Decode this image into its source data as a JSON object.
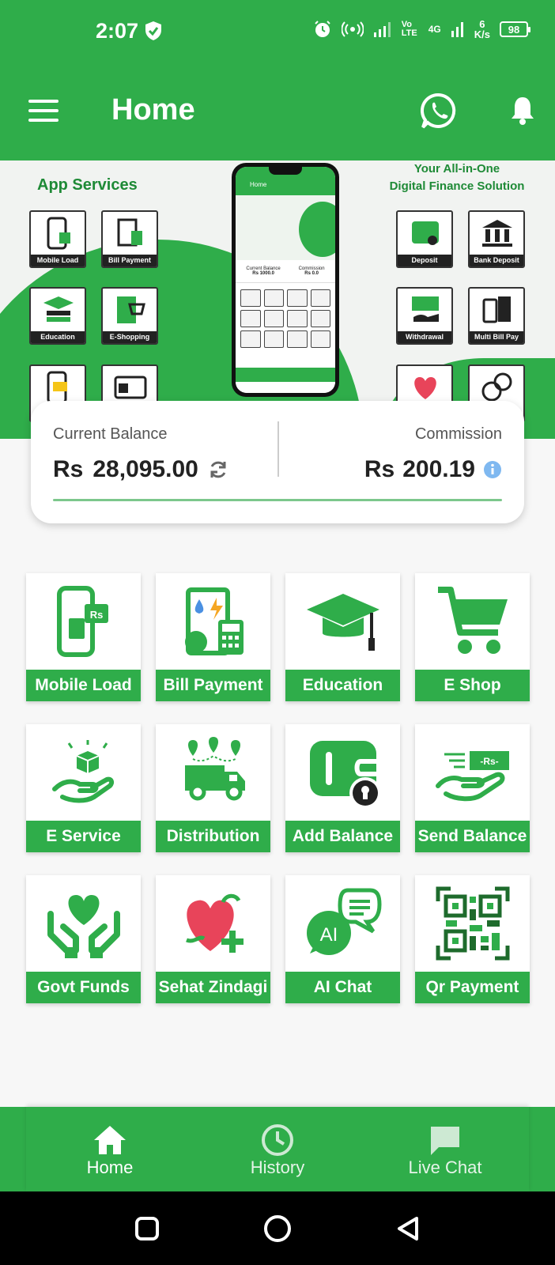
{
  "status_bar": {
    "time": "2:07",
    "network_label": "Vo LTE",
    "network_type": "4G",
    "speed_value": "6",
    "speed_unit": "K/s",
    "battery": "98"
  },
  "header": {
    "title": "Home",
    "menu_icon": "hamburger-menu-icon",
    "whatsapp_icon": "whatsapp-icon",
    "notification_icon": "bell-icon"
  },
  "banner": {
    "left_title": "App Services",
    "right_title_line1": "Your All-in-One",
    "right_title_line2": "Digital Finance Solution",
    "left_tiles": [
      "Mobile Load",
      "Bill Payment",
      "Education",
      "E-Shopping",
      "",
      ""
    ],
    "right_tiles": [
      "Deposit",
      "Bank Deposit",
      "Withdrawal",
      "Multi Bill Pay",
      "",
      ""
    ],
    "phone": {
      "title": "Home",
      "balance_label": "Current Balance",
      "balance_value": "Rs 1000.0",
      "commission_label": "Commission",
      "commission_value": "Rs 0.0"
    }
  },
  "balance_card": {
    "current_label": "Current Balance",
    "current_currency": "Rs",
    "current_value": "28,095.00",
    "commission_label": "Commission",
    "commission_currency": "Rs",
    "commission_value": "200.19"
  },
  "services": [
    {
      "label": "Mobile Load",
      "icon": "mobile-load-icon"
    },
    {
      "label": "Bill Payment",
      "icon": "bill-payment-icon"
    },
    {
      "label": "Education",
      "icon": "graduation-cap-icon"
    },
    {
      "label": "E Shop",
      "icon": "shopping-cart-icon"
    },
    {
      "label": "E Service",
      "icon": "hand-box-icon"
    },
    {
      "label": "Distribution",
      "icon": "delivery-truck-icon"
    },
    {
      "label": "Add Balance",
      "icon": "wallet-icon"
    },
    {
      "label": "Send Balance",
      "icon": "send-money-icon"
    },
    {
      "label": "Govt Funds",
      "icon": "hands-heart-icon"
    },
    {
      "label": "Sehat Zindagi",
      "icon": "heart-health-icon"
    },
    {
      "label": "AI Chat",
      "icon": "ai-chat-icon"
    },
    {
      "label": "Qr Payment",
      "icon": "qr-code-icon"
    }
  ],
  "bottom_nav": [
    {
      "label": "Home",
      "icon": "home-icon"
    },
    {
      "label": "History",
      "icon": "clock-icon"
    },
    {
      "label": "Live Chat",
      "icon": "chat-bubble-icon"
    }
  ],
  "colors": {
    "primary": "#2fad4a",
    "dark_green": "#1e8a36",
    "info_blue": "#4a90e2"
  }
}
